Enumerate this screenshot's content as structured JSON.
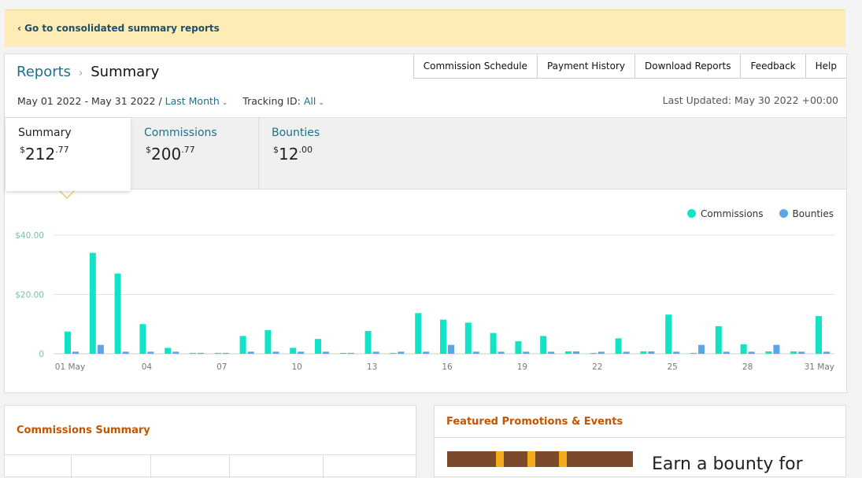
{
  "banner": {
    "link_label": "‹ Go to consolidated summary reports"
  },
  "breadcrumb": {
    "root": "Reports",
    "separator": "›",
    "current": "Summary"
  },
  "topnav": [
    "Commission Schedule",
    "Payment History",
    "Download Reports",
    "Feedback",
    "Help"
  ],
  "filters": {
    "date_range": "May 01 2022 - May 31 2022 /",
    "period": "Last Month",
    "tracking_label": "Tracking ID:",
    "tracking_value": "All"
  },
  "last_updated": "Last Updated: May 30 2022 +00:00",
  "tabs": [
    {
      "label": "Summary",
      "currency": "$",
      "whole": "212",
      "cents": ".77"
    },
    {
      "label": "Commissions",
      "currency": "$",
      "whole": "200",
      "cents": ".77"
    },
    {
      "label": "Bounties",
      "currency": "$",
      "whole": "12",
      "cents": ".00"
    }
  ],
  "colors": {
    "commissions": "#12e3c4",
    "bounties": "#5aa6e6",
    "accent_orange": "#c45500",
    "link": "#1f6f8b",
    "banner_bg": "#fdecb6"
  },
  "chart_data": {
    "type": "bar",
    "x": [
      "01 May",
      "02",
      "03",
      "04",
      "05",
      "06",
      "07",
      "08",
      "09",
      "10",
      "11",
      "12",
      "13",
      "14",
      "15",
      "16",
      "17",
      "18",
      "19",
      "20",
      "21",
      "22",
      "23",
      "24",
      "25",
      "26",
      "27",
      "28",
      "29",
      "30",
      "31 May"
    ],
    "x_tick_labels": [
      "01 May",
      "04",
      "07",
      "10",
      "13",
      "16",
      "19",
      "22",
      "25",
      "28",
      "31 May"
    ],
    "y_tick_labels": [
      "$40.00",
      "$20.00",
      "0"
    ],
    "ylim": [
      0,
      40
    ],
    "grid": true,
    "legend": "top-right",
    "series": [
      {
        "name": "Commissions",
        "values": [
          7.5,
          34,
          27,
          10,
          2,
          0.3,
          0.3,
          6,
          8,
          2,
          5,
          0.3,
          7.7,
          0.3,
          13.7,
          11.5,
          10.5,
          7,
          4.2,
          6,
          0.8,
          0.3,
          5.2,
          0.8,
          13.2,
          0.3,
          9.3,
          3.2,
          0.8,
          0.8,
          12.7
        ]
      },
      {
        "name": "Bounties",
        "values": [
          0.7,
          3,
          0.7,
          0.7,
          0.7,
          0.3,
          0.3,
          0.7,
          0.7,
          0.7,
          0.7,
          0.3,
          0.7,
          0.7,
          0.7,
          3,
          0.7,
          0.7,
          0.7,
          0.7,
          0.8,
          0.7,
          0.7,
          0.8,
          0.7,
          3,
          0.7,
          0.7,
          3,
          0.7,
          0.7
        ]
      }
    ]
  },
  "commissions_summary": {
    "title": "Commissions Summary"
  },
  "promotions": {
    "title": "Featured Promotions & Events",
    "teaser": "Earn a bounty for"
  }
}
